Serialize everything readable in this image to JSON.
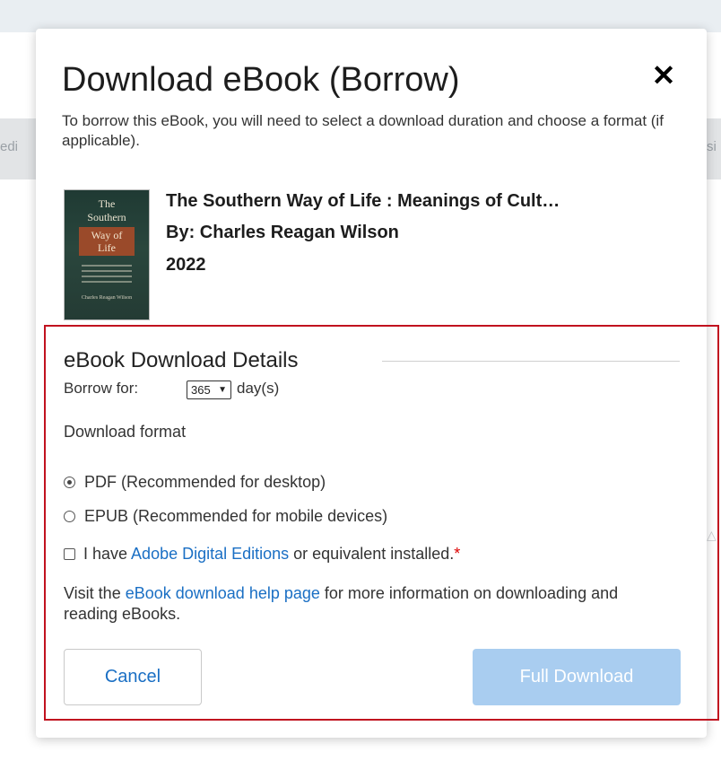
{
  "background": {
    "partial_left": "edi",
    "partial_right": "si",
    "partial_caret": "△"
  },
  "modal": {
    "title": "Download eBook (Borrow)",
    "close_glyph": "✕",
    "intro": "To borrow this eBook, you will need to select a download duration and choose a format (if applicable).",
    "book": {
      "title": "The Southern Way of Life : Meanings of Cult…",
      "author": "By: Charles Reagan Wilson",
      "year": "2022",
      "cover": {
        "line1": "The",
        "line2": "Southern",
        "line3": "Way of",
        "line4": "Life",
        "author": "Charles Reagan Wilson"
      }
    },
    "details": {
      "legend": "eBook Download Details",
      "borrow_label": "Borrow for:",
      "borrow_value": "365",
      "borrow_unit": "day(s)",
      "format_label": "Download format",
      "formats": [
        {
          "label": "PDF (Recommended for desktop)",
          "selected": true
        },
        {
          "label": "EPUB (Recommended for mobile devices)",
          "selected": false
        }
      ],
      "confirm_prefix": "I have ",
      "confirm_link": "Adobe Digital Editions",
      "confirm_suffix": " or equivalent installed.",
      "required_mark": "*",
      "visit_prefix": "Visit the ",
      "visit_link": "eBook download help page",
      "visit_suffix": " for more information on downloading and reading eBooks."
    },
    "buttons": {
      "cancel": "Cancel",
      "full_download": "Full Download"
    }
  },
  "colors": {
    "accent_link": "#1a6fc4",
    "highlight_border": "#c1121f",
    "disabled_button": "#a9cdf0"
  }
}
